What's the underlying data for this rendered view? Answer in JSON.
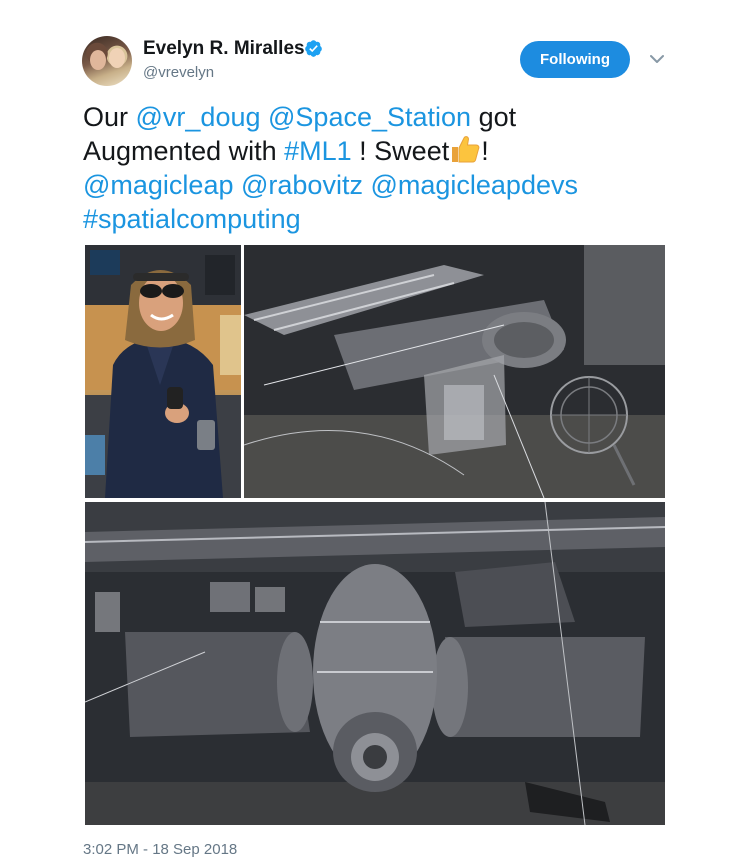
{
  "user": {
    "name": "Evelyn R. Miralles",
    "handle": "@vrevelyn",
    "verified": true
  },
  "follow_button": {
    "label": "Following",
    "color": "#1d8ce0"
  },
  "tweet": {
    "segments": {
      "s1": "Our ",
      "m1": "@vr_doug",
      "s2": " ",
      "m2": "@Space_Station",
      "s3": " got",
      "s4": "Augmented with ",
      "h1": "#ML1",
      "s5": " ! Sweet",
      "s6": "!",
      "m3": "@magicleap",
      "s7": " ",
      "m4": "@rabovitz",
      "s8": " ",
      "m5": "@magicleapdevs",
      "h2": "#spatialcomputing"
    },
    "link_color": "#1b95e0",
    "emoji": "thumbs-up-icon"
  },
  "media": {
    "count": 3,
    "items": [
      {
        "name": "photo-woman-with-headset"
      },
      {
        "name": "photo-space-station-ar-1"
      },
      {
        "name": "photo-space-station-ar-2"
      }
    ]
  },
  "timestamp": "3:02 PM - 18 Sep 2018"
}
